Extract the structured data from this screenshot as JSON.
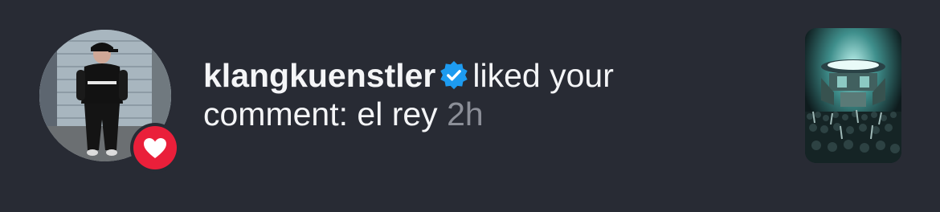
{
  "notification": {
    "username": "klangkuenstler",
    "verified_icon": "verified-badge-icon",
    "action_text": "liked your",
    "comment_line": "comment: el rey",
    "time": "2h",
    "badge_icon": "heart-icon",
    "colors": {
      "background": "#282b34",
      "text": "#f4f5f7",
      "time": "#8c8f98",
      "verified": "#1d9bf0",
      "heart_badge": "#ea1f3a"
    }
  }
}
